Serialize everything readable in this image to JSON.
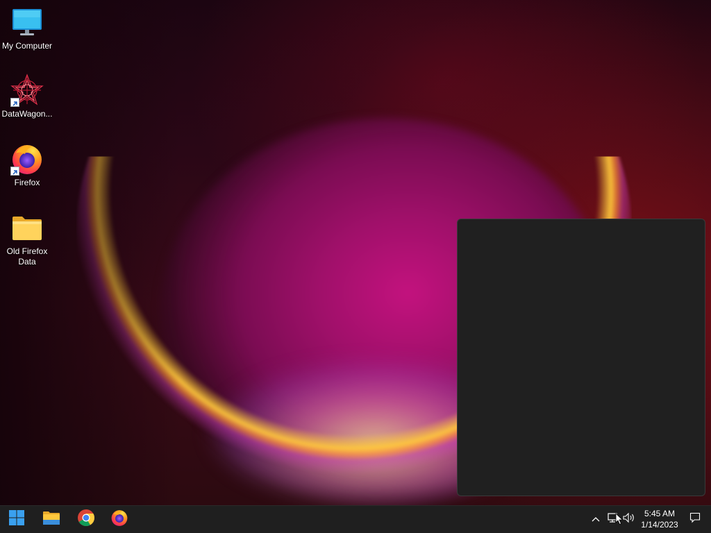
{
  "desktop": {
    "icons": [
      {
        "label": "My Computer"
      },
      {
        "label": "DataWagon..."
      },
      {
        "label": "Firefox"
      },
      {
        "label": "Old Firefox Data"
      }
    ]
  },
  "taskbar": {
    "start_icon": "windows-logo-icon",
    "pinned": [
      {
        "icon": "file-explorer-icon"
      },
      {
        "icon": "chrome-icon"
      },
      {
        "icon": "firefox-icon"
      }
    ],
    "tray": {
      "overflow_icon": "chevron-up-icon",
      "network_icon": "network-icon",
      "volume_icon": "volume-icon",
      "notification_icon": "notification-icon"
    },
    "clock": {
      "time": "5:45 AM",
      "date": "1/14/2023"
    }
  },
  "colors": {
    "taskbar_bg": "#1f1f1f",
    "flyout_bg": "#202020",
    "accent": "#0078d4"
  }
}
